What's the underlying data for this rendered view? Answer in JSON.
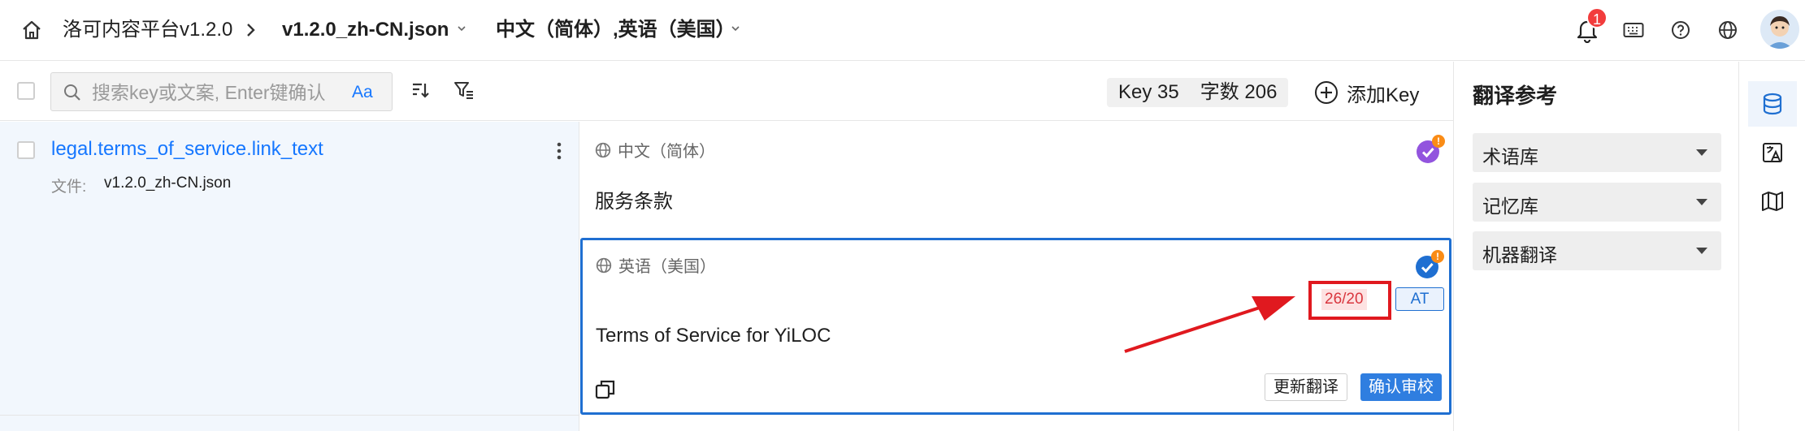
{
  "header": {
    "app_title": "洛可内容平台v1.2.0",
    "file_name": "v1.2.0_zh-CN.json",
    "languages": "中文（简体）,英语（美国）",
    "notification_count": "1"
  },
  "toolbar": {
    "search_placeholder": "搜索key或文案, Enter键确认",
    "match_case_label": "Aa",
    "key_count": "Key 35",
    "word_count": "字数 206",
    "add_key_label": "添加Key"
  },
  "key_list": {
    "items": [
      {
        "key": "legal.terms_of_service.link_text",
        "file_label": "文件:",
        "file_value": "v1.2.0_zh-CN.json"
      }
    ]
  },
  "editor": {
    "source": {
      "language": "中文（简体）",
      "text": "服务条款",
      "warning": "!"
    },
    "target": {
      "language": "英语（美国）",
      "text": "Terms of Service for YiLOC",
      "char_counter": "26/20",
      "tag": "AT",
      "warning": "!",
      "update_button": "更新翻译",
      "confirm_button": "确认审校"
    }
  },
  "reference_panel": {
    "title": "翻译参考",
    "sections": [
      "术语库",
      "记忆库",
      "机器翻译"
    ]
  },
  "colors": {
    "accent": "#1677ff",
    "primary_button": "#2f7ee0",
    "alert": "#e0191f",
    "source_status": "#9254de"
  }
}
